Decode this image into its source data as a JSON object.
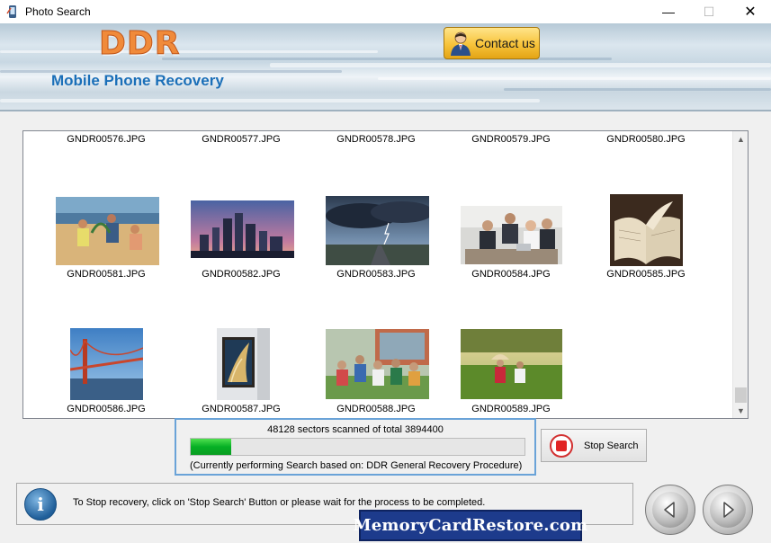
{
  "window": {
    "title": "Photo Search",
    "min_glyph": "—",
    "max_glyph": "☐",
    "close_glyph": "✕"
  },
  "banner": {
    "brand": "DDR",
    "product": "Mobile Phone Recovery",
    "contact_label": "Contact us"
  },
  "gallery": {
    "files": [
      {
        "name": "GNDR00576.JPG",
        "thumbnail": "none"
      },
      {
        "name": "GNDR00577.JPG",
        "thumbnail": "none"
      },
      {
        "name": "GNDR00578.JPG",
        "thumbnail": "none"
      },
      {
        "name": "GNDR00579.JPG",
        "thumbnail": "none"
      },
      {
        "name": "GNDR00580.JPG",
        "thumbnail": "none"
      },
      {
        "name": "GNDR00581.JPG",
        "thumbnail": "beach-family-photo"
      },
      {
        "name": "GNDR00582.JPG",
        "thumbnail": "city-skyline-photo"
      },
      {
        "name": "GNDR00583.JPG",
        "thumbnail": "storm-road-photo"
      },
      {
        "name": "GNDR00584.JPG",
        "thumbnail": "business-meeting-photo"
      },
      {
        "name": "GNDR00585.JPG",
        "thumbnail": "open-book-photo"
      },
      {
        "name": "GNDR00586.JPG",
        "thumbnail": "golden-gate-bridge-photo"
      },
      {
        "name": "GNDR00587.JPG",
        "thumbnail": "framed-painting-photo"
      },
      {
        "name": "GNDR00588.JPG",
        "thumbnail": "students-group-photo"
      },
      {
        "name": "GNDR00589.JPG",
        "thumbnail": "couple-field-photo"
      }
    ]
  },
  "progress": {
    "status": "48128 sectors scanned of total 3894400",
    "fraction": 0.012,
    "method": "(Currently performing Search based on:  DDR General Recovery Procedure)"
  },
  "stop_button": {
    "label": "Stop Search",
    "icon": "stop-icon"
  },
  "infobar": {
    "message": "To Stop recovery, click on 'Stop Search' Button or please wait for the process to be completed.",
    "icon_glyph": "i"
  },
  "watermark": "MemoryCardRestore.com",
  "colors": {
    "accent": "#6aa3d8",
    "progress_fill": "#06b025",
    "brand_orange": "#f08a3a",
    "product_blue": "#1b6fb8"
  }
}
